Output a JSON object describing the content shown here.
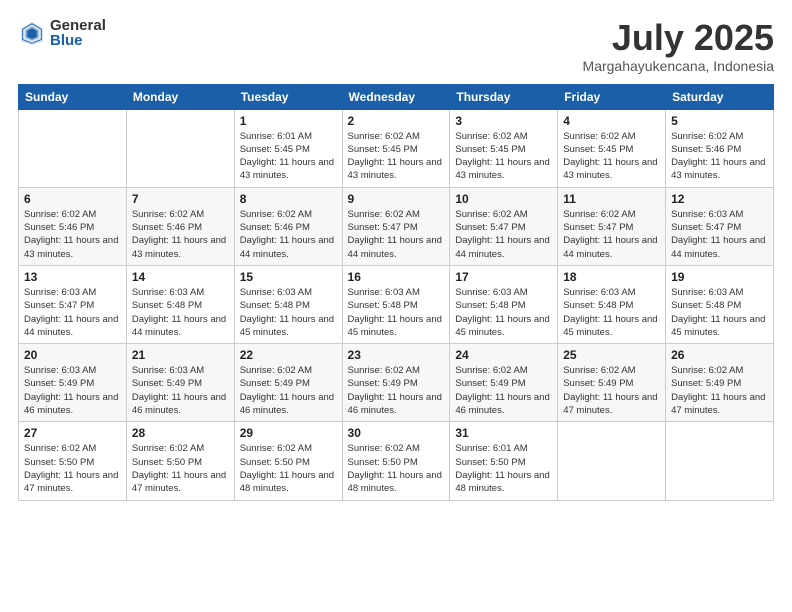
{
  "logo": {
    "general": "General",
    "blue": "Blue"
  },
  "header": {
    "month": "July 2025",
    "location": "Margahayukencana, Indonesia"
  },
  "weekdays": [
    "Sunday",
    "Monday",
    "Tuesday",
    "Wednesday",
    "Thursday",
    "Friday",
    "Saturday"
  ],
  "weeks": [
    [
      {
        "day": "",
        "sunrise": "",
        "sunset": "",
        "daylight": ""
      },
      {
        "day": "",
        "sunrise": "",
        "sunset": "",
        "daylight": ""
      },
      {
        "day": "1",
        "sunrise": "Sunrise: 6:01 AM",
        "sunset": "Sunset: 5:45 PM",
        "daylight": "Daylight: 11 hours and 43 minutes."
      },
      {
        "day": "2",
        "sunrise": "Sunrise: 6:02 AM",
        "sunset": "Sunset: 5:45 PM",
        "daylight": "Daylight: 11 hours and 43 minutes."
      },
      {
        "day": "3",
        "sunrise": "Sunrise: 6:02 AM",
        "sunset": "Sunset: 5:45 PM",
        "daylight": "Daylight: 11 hours and 43 minutes."
      },
      {
        "day": "4",
        "sunrise": "Sunrise: 6:02 AM",
        "sunset": "Sunset: 5:45 PM",
        "daylight": "Daylight: 11 hours and 43 minutes."
      },
      {
        "day": "5",
        "sunrise": "Sunrise: 6:02 AM",
        "sunset": "Sunset: 5:46 PM",
        "daylight": "Daylight: 11 hours and 43 minutes."
      }
    ],
    [
      {
        "day": "6",
        "sunrise": "Sunrise: 6:02 AM",
        "sunset": "Sunset: 5:46 PM",
        "daylight": "Daylight: 11 hours and 43 minutes."
      },
      {
        "day": "7",
        "sunrise": "Sunrise: 6:02 AM",
        "sunset": "Sunset: 5:46 PM",
        "daylight": "Daylight: 11 hours and 43 minutes."
      },
      {
        "day": "8",
        "sunrise": "Sunrise: 6:02 AM",
        "sunset": "Sunset: 5:46 PM",
        "daylight": "Daylight: 11 hours and 44 minutes."
      },
      {
        "day": "9",
        "sunrise": "Sunrise: 6:02 AM",
        "sunset": "Sunset: 5:47 PM",
        "daylight": "Daylight: 11 hours and 44 minutes."
      },
      {
        "day": "10",
        "sunrise": "Sunrise: 6:02 AM",
        "sunset": "Sunset: 5:47 PM",
        "daylight": "Daylight: 11 hours and 44 minutes."
      },
      {
        "day": "11",
        "sunrise": "Sunrise: 6:02 AM",
        "sunset": "Sunset: 5:47 PM",
        "daylight": "Daylight: 11 hours and 44 minutes."
      },
      {
        "day": "12",
        "sunrise": "Sunrise: 6:03 AM",
        "sunset": "Sunset: 5:47 PM",
        "daylight": "Daylight: 11 hours and 44 minutes."
      }
    ],
    [
      {
        "day": "13",
        "sunrise": "Sunrise: 6:03 AM",
        "sunset": "Sunset: 5:47 PM",
        "daylight": "Daylight: 11 hours and 44 minutes."
      },
      {
        "day": "14",
        "sunrise": "Sunrise: 6:03 AM",
        "sunset": "Sunset: 5:48 PM",
        "daylight": "Daylight: 11 hours and 44 minutes."
      },
      {
        "day": "15",
        "sunrise": "Sunrise: 6:03 AM",
        "sunset": "Sunset: 5:48 PM",
        "daylight": "Daylight: 11 hours and 45 minutes."
      },
      {
        "day": "16",
        "sunrise": "Sunrise: 6:03 AM",
        "sunset": "Sunset: 5:48 PM",
        "daylight": "Daylight: 11 hours and 45 minutes."
      },
      {
        "day": "17",
        "sunrise": "Sunrise: 6:03 AM",
        "sunset": "Sunset: 5:48 PM",
        "daylight": "Daylight: 11 hours and 45 minutes."
      },
      {
        "day": "18",
        "sunrise": "Sunrise: 6:03 AM",
        "sunset": "Sunset: 5:48 PM",
        "daylight": "Daylight: 11 hours and 45 minutes."
      },
      {
        "day": "19",
        "sunrise": "Sunrise: 6:03 AM",
        "sunset": "Sunset: 5:48 PM",
        "daylight": "Daylight: 11 hours and 45 minutes."
      }
    ],
    [
      {
        "day": "20",
        "sunrise": "Sunrise: 6:03 AM",
        "sunset": "Sunset: 5:49 PM",
        "daylight": "Daylight: 11 hours and 46 minutes."
      },
      {
        "day": "21",
        "sunrise": "Sunrise: 6:03 AM",
        "sunset": "Sunset: 5:49 PM",
        "daylight": "Daylight: 11 hours and 46 minutes."
      },
      {
        "day": "22",
        "sunrise": "Sunrise: 6:02 AM",
        "sunset": "Sunset: 5:49 PM",
        "daylight": "Daylight: 11 hours and 46 minutes."
      },
      {
        "day": "23",
        "sunrise": "Sunrise: 6:02 AM",
        "sunset": "Sunset: 5:49 PM",
        "daylight": "Daylight: 11 hours and 46 minutes."
      },
      {
        "day": "24",
        "sunrise": "Sunrise: 6:02 AM",
        "sunset": "Sunset: 5:49 PM",
        "daylight": "Daylight: 11 hours and 46 minutes."
      },
      {
        "day": "25",
        "sunrise": "Sunrise: 6:02 AM",
        "sunset": "Sunset: 5:49 PM",
        "daylight": "Daylight: 11 hours and 47 minutes."
      },
      {
        "day": "26",
        "sunrise": "Sunrise: 6:02 AM",
        "sunset": "Sunset: 5:49 PM",
        "daylight": "Daylight: 11 hours and 47 minutes."
      }
    ],
    [
      {
        "day": "27",
        "sunrise": "Sunrise: 6:02 AM",
        "sunset": "Sunset: 5:50 PM",
        "daylight": "Daylight: 11 hours and 47 minutes."
      },
      {
        "day": "28",
        "sunrise": "Sunrise: 6:02 AM",
        "sunset": "Sunset: 5:50 PM",
        "daylight": "Daylight: 11 hours and 47 minutes."
      },
      {
        "day": "29",
        "sunrise": "Sunrise: 6:02 AM",
        "sunset": "Sunset: 5:50 PM",
        "daylight": "Daylight: 11 hours and 48 minutes."
      },
      {
        "day": "30",
        "sunrise": "Sunrise: 6:02 AM",
        "sunset": "Sunset: 5:50 PM",
        "daylight": "Daylight: 11 hours and 48 minutes."
      },
      {
        "day": "31",
        "sunrise": "Sunrise: 6:01 AM",
        "sunset": "Sunset: 5:50 PM",
        "daylight": "Daylight: 11 hours and 48 minutes."
      },
      {
        "day": "",
        "sunrise": "",
        "sunset": "",
        "daylight": ""
      },
      {
        "day": "",
        "sunrise": "",
        "sunset": "",
        "daylight": ""
      }
    ]
  ]
}
